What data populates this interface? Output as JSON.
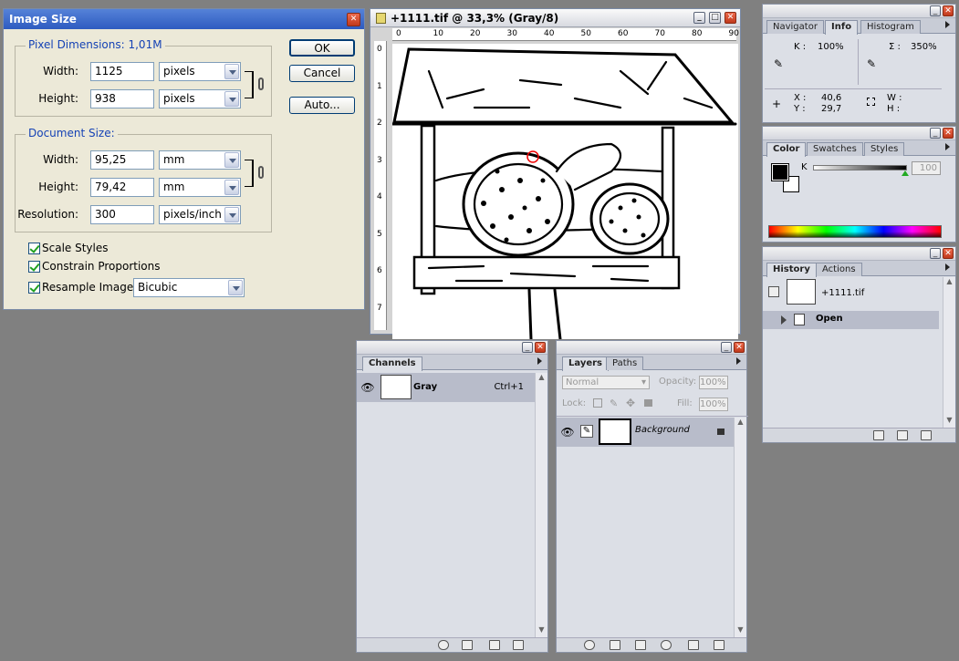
{
  "image_size_dialog": {
    "title": "Image Size",
    "pixel_dimensions": {
      "label": "Pixel Dimensions:",
      "size": "1,01M",
      "width_label": "Width:",
      "width_value": "1125",
      "width_unit": "pixels",
      "height_label": "Height:",
      "height_value": "938",
      "height_unit": "pixels"
    },
    "document_size": {
      "label": "Document Size:",
      "width_label": "Width:",
      "width_value": "95,25",
      "width_unit": "mm",
      "height_label": "Height:",
      "height_value": "79,42",
      "height_unit": "mm",
      "resolution_label": "Resolution:",
      "resolution_value": "300",
      "resolution_unit": "pixels/inch"
    },
    "checkboxes": {
      "scale_styles": "Scale Styles",
      "constrain": "Constrain Proportions",
      "resample": "Resample Image:"
    },
    "resample_method": "Bicubic",
    "buttons": {
      "ok": "OK",
      "cancel": "Cancel",
      "auto": "Auto..."
    }
  },
  "document_window": {
    "title": "+1111.tif @ 33,3% (Gray/8)",
    "ruler_h": [
      "0",
      "10",
      "20",
      "30",
      "40",
      "50",
      "60",
      "70",
      "80",
      "90"
    ],
    "ruler_v": [
      "0",
      "1",
      "2",
      "3",
      "4",
      "5",
      "6",
      "7"
    ]
  },
  "info_panel": {
    "tabs": [
      "Navigator",
      "Info",
      "Histogram"
    ],
    "k_label": "K :",
    "k_value": "100%",
    "sigma_label": "Σ :",
    "sigma_value": "350%",
    "x_label": "X :",
    "x_value": "40,6",
    "y_label": "Y :",
    "y_value": "29,7",
    "w_label": "W :",
    "h_label": "H :"
  },
  "color_panel": {
    "tabs": [
      "Color",
      "Swatches",
      "Styles"
    ],
    "k_label": "K",
    "k_value": "100"
  },
  "history_panel": {
    "tabs": [
      "History",
      "Actions"
    ],
    "snapshot": "+1111.tif",
    "state": "Open"
  },
  "channels_panel": {
    "tab": "Channels",
    "channel_name": "Gray",
    "shortcut": "Ctrl+1"
  },
  "layers_panel": {
    "tabs": [
      "Layers",
      "Paths"
    ],
    "blend_mode": "Normal",
    "opacity_label": "Opacity:",
    "opacity_value": "100%",
    "lock_label": "Lock:",
    "fill_label": "Fill:",
    "fill_value": "100%",
    "layer_name": "Background"
  }
}
